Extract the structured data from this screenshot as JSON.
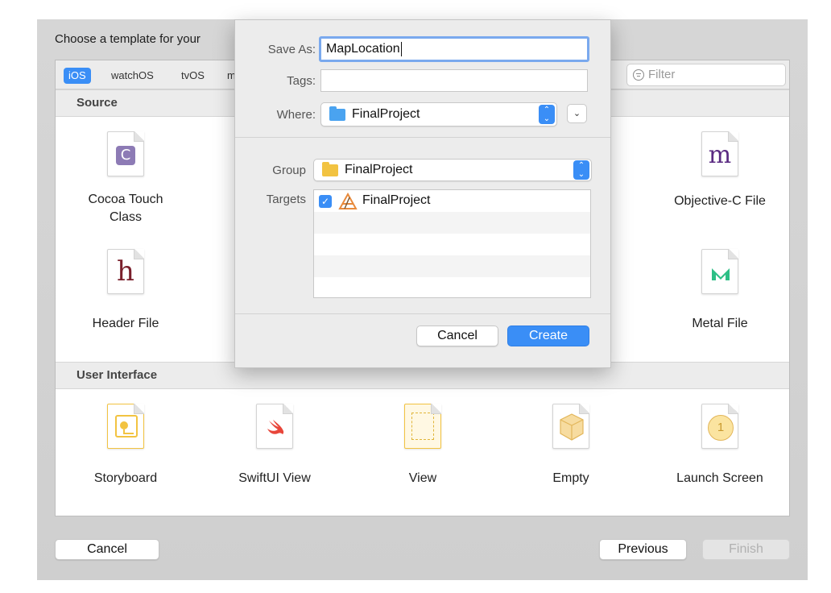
{
  "chooser": {
    "title": "Choose a template for your",
    "platforms": [
      "iOS",
      "watchOS",
      "tvOS",
      "m"
    ],
    "filter_placeholder": "Filter",
    "sections": {
      "source": "Source",
      "user_interface": "User Interface"
    },
    "source_templates": [
      {
        "label": "Cocoa Touch\nClass",
        "glyph": "C"
      },
      {
        "label": "Objective-C File",
        "glyph": "m"
      },
      {
        "label": "Header File",
        "glyph": "h"
      },
      {
        "label": "Metal File",
        "glyph": "M"
      }
    ],
    "ui_templates": [
      {
        "label": "Storyboard"
      },
      {
        "label": "SwiftUI View"
      },
      {
        "label": "View"
      },
      {
        "label": "Empty"
      },
      {
        "label": "Launch Screen",
        "glyph": "1"
      }
    ],
    "buttons": {
      "cancel": "Cancel",
      "previous": "Previous",
      "finish": "Finish"
    }
  },
  "save_dialog": {
    "save_as_label": "Save As:",
    "save_as_value": "MapLocation",
    "tags_label": "Tags:",
    "tags_value": "",
    "where_label": "Where:",
    "where_value": "FinalProject",
    "group_label": "Group",
    "group_value": "FinalProject",
    "targets_label": "Targets",
    "targets": [
      {
        "name": "FinalProject",
        "checked": true
      }
    ],
    "cancel_label": "Cancel",
    "create_label": "Create",
    "check_glyph": "✓",
    "stepper_glyph": "⌃\n⌄",
    "disclosure_glyph": "⌄"
  },
  "colors": {
    "accent": "#3a8ef6",
    "cocoa_icon": "#8d7bb5",
    "objc_glyph": "#5a2a82",
    "header_glyph": "#7a1f2b",
    "metal_glyph": "#2dbf86",
    "swift_icon": "#e8463a",
    "storyboard": "#f2c341"
  }
}
